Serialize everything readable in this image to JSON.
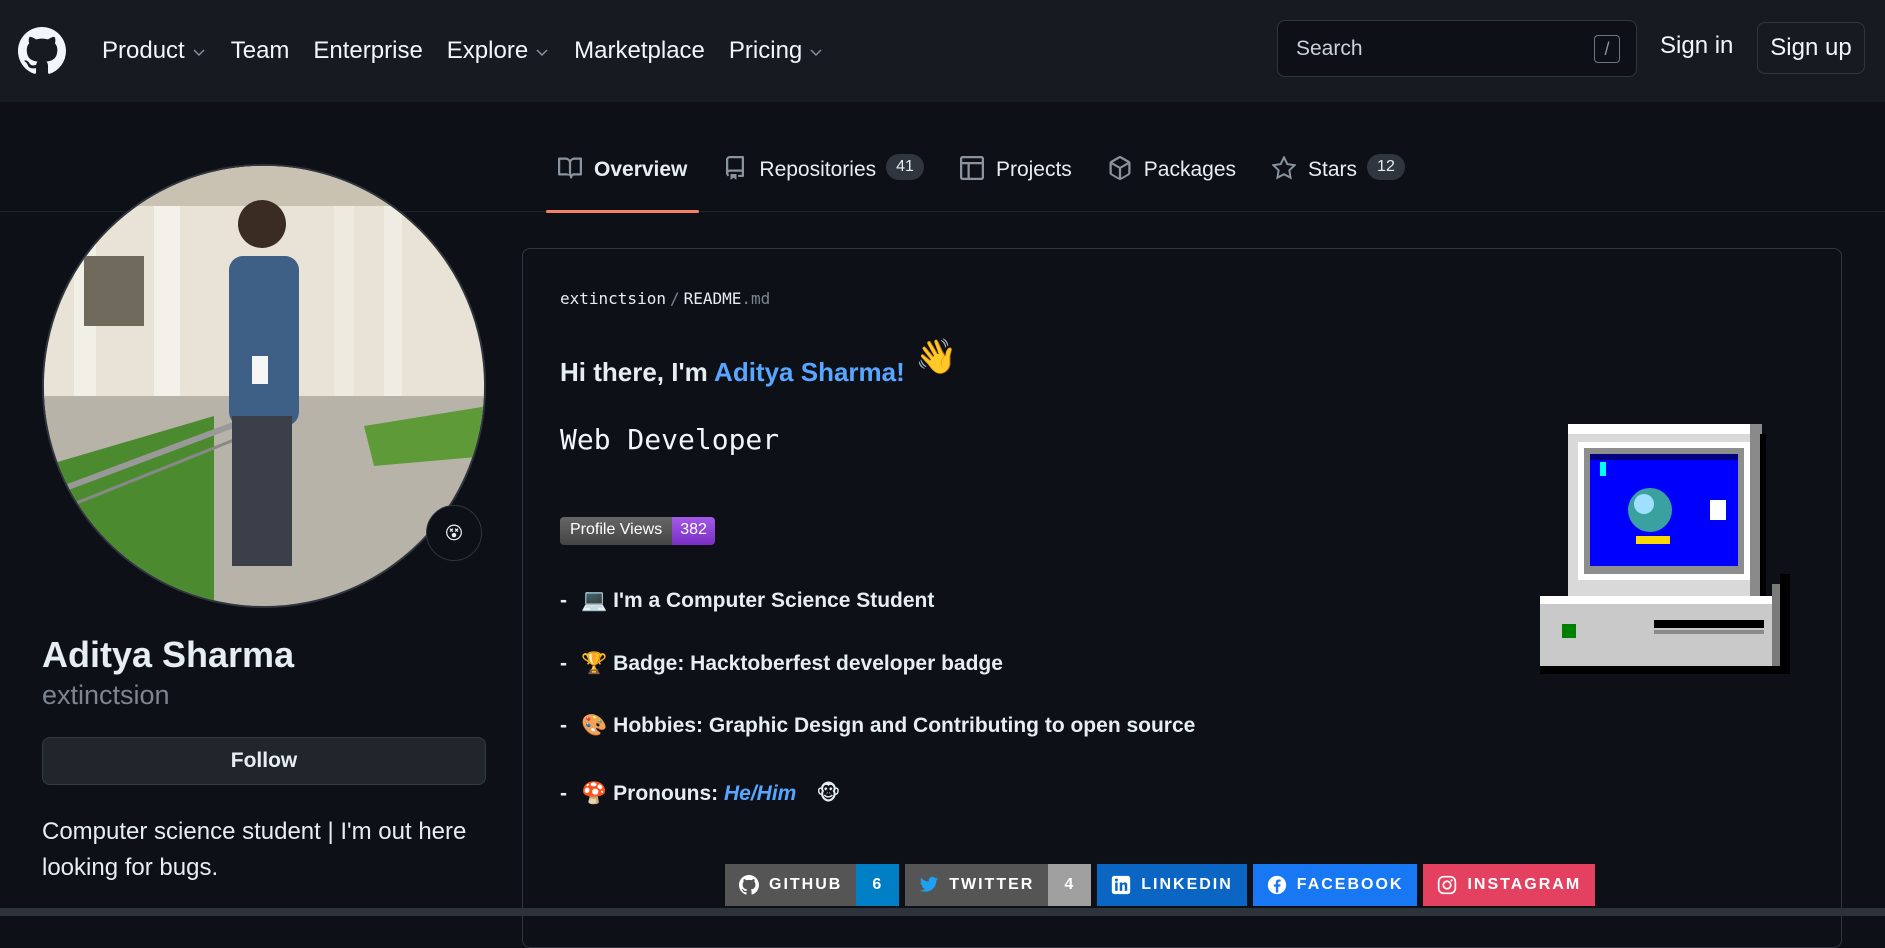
{
  "header": {
    "nav": [
      {
        "label": "Product",
        "dropdown": true
      },
      {
        "label": "Team",
        "dropdown": false
      },
      {
        "label": "Enterprise",
        "dropdown": false
      },
      {
        "label": "Explore",
        "dropdown": true
      },
      {
        "label": "Marketplace",
        "dropdown": false
      },
      {
        "label": "Pricing",
        "dropdown": true
      }
    ],
    "search_placeholder": "Search",
    "search_shortcut": "/",
    "sign_in": "Sign in",
    "sign_up": "Sign up"
  },
  "tabs": [
    {
      "label": "Overview",
      "active": true,
      "icon": "book-icon"
    },
    {
      "label": "Repositories",
      "count": "41",
      "icon": "repo-icon"
    },
    {
      "label": "Projects",
      "icon": "project-icon"
    },
    {
      "label": "Packages",
      "icon": "package-icon"
    },
    {
      "label": "Stars",
      "count": "12",
      "icon": "star-icon"
    }
  ],
  "profile": {
    "name": "Aditya Sharma",
    "login": "extinctsion",
    "follow_label": "Follow",
    "bio": "Computer science student | I'm out here looking for bugs.",
    "status_emoji": "😵"
  },
  "readme": {
    "owner": "extinctsion",
    "sep": "/",
    "file": "README",
    "ext": ".md",
    "greeting_prefix": "Hi there, I'm ",
    "greeting_name": "Aditya Sharma!",
    "wave": "👋",
    "role": "Web Developer",
    "badge_label": "Profile Views",
    "badge_value": "382",
    "items": [
      {
        "dash": "-",
        "emoji": "💻",
        "text": "I'm a Computer Science Student"
      },
      {
        "dash": "-",
        "emoji": "🏆",
        "text": "Badge: Hacktoberfest developer badge"
      },
      {
        "dash": "-",
        "emoji": "🎨",
        "text": "Hobbies: Graphic Design and Contributing to open source"
      }
    ],
    "pronouns": {
      "dash": "-",
      "emoji": "🍄",
      "label": "Pronouns: ",
      "value": "He/Him",
      "suffix": "🐵"
    },
    "socials": [
      {
        "label": "GITHUB",
        "count": "6",
        "bg": "#555555",
        "count_bg": "#007ec6",
        "icon": "github-icon"
      },
      {
        "label": "TWITTER",
        "count": "4",
        "bg": "#555555",
        "count_bg": "#9f9f9f",
        "icon": "twitter-icon"
      },
      {
        "label": "LINKEDIN",
        "bg": "#0a66c2",
        "icon": "linkedin-icon"
      },
      {
        "label": "FACEBOOK",
        "bg": "#1877f2",
        "icon": "facebook-icon"
      },
      {
        "label": "INSTAGRAM",
        "bg": "#e4405f",
        "icon": "instagram-icon"
      }
    ]
  },
  "colors": {
    "bg": "#0d1117",
    "header_bg": "#161b22",
    "link": "#58a6ff",
    "tab_underline": "#f78166"
  }
}
